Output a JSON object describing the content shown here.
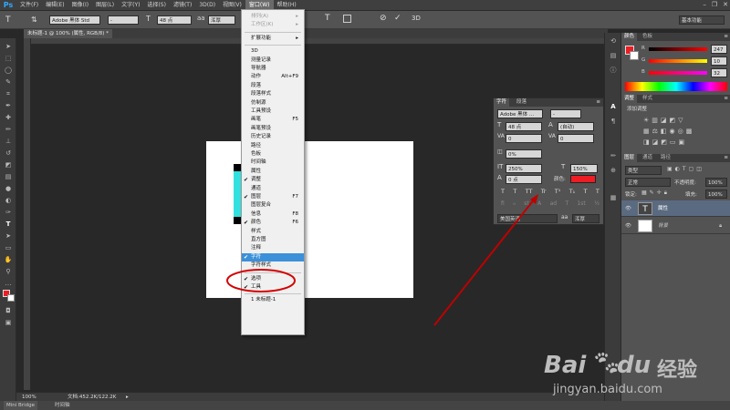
{
  "app": {
    "logo": "Ps"
  },
  "menubar": {
    "items": [
      "文件(F)",
      "编辑(E)",
      "图像(I)",
      "图层(L)",
      "文字(Y)",
      "选择(S)",
      "滤镜(T)",
      "3D(D)",
      "视图(V)",
      "窗口(W)",
      "帮助(H)"
    ],
    "active_index": 9
  },
  "options": {
    "font_family": "Adobe 黑体 Std",
    "font_style": "-",
    "font_size": "48 点",
    "antialias": "浑厚",
    "workspace": "基本功能"
  },
  "document": {
    "tab_title": "未标题-1 @ 100% (属性, RGB/8) *",
    "zoom": "100%",
    "doc_size": "文档:452.2K/122.2K"
  },
  "bottom_tabs": [
    "Mini Bridge",
    "时间轴"
  ],
  "dropdown": {
    "items": [
      {
        "label": "排列(A)",
        "submenu": true,
        "disabled": true
      },
      {
        "label": "工作区(K)",
        "submenu": true,
        "disabled": true
      },
      {
        "sep": true
      },
      {
        "label": "扩展功能",
        "submenu": true
      },
      {
        "sep": true
      },
      {
        "label": "3D"
      },
      {
        "label": "测量记录"
      },
      {
        "label": "导航器"
      },
      {
        "label": "动作",
        "shortcut": "Alt+F9"
      },
      {
        "label": "段落"
      },
      {
        "label": "段落样式"
      },
      {
        "label": "仿制源"
      },
      {
        "label": "工具预设"
      },
      {
        "label": "画笔",
        "shortcut": "F5"
      },
      {
        "label": "画笔预设"
      },
      {
        "label": "历史记录"
      },
      {
        "label": "路径"
      },
      {
        "label": "色板"
      },
      {
        "label": "时间轴"
      },
      {
        "label": "属性"
      },
      {
        "label": "调整",
        "checked": true
      },
      {
        "label": "通道"
      },
      {
        "label": "图层",
        "shortcut": "F7",
        "checked": true
      },
      {
        "label": "图层复合"
      },
      {
        "label": "信息",
        "shortcut": "F8"
      },
      {
        "label": "颜色",
        "shortcut": "F6",
        "checked": true
      },
      {
        "label": "样式"
      },
      {
        "label": "直方图"
      },
      {
        "label": "注释"
      },
      {
        "label": "字符",
        "checked": true,
        "selected": true
      },
      {
        "label": "字符样式"
      },
      {
        "sep": true
      },
      {
        "label": "选项",
        "checked": true
      },
      {
        "label": "工具",
        "checked": true
      },
      {
        "sep": true
      },
      {
        "label": "1 未标题-1"
      }
    ]
  },
  "char_panel": {
    "tabs": [
      "字符",
      "段落"
    ],
    "font_family": "Adobe 黑体 ...",
    "font_style": "-",
    "size": "48 点",
    "leading": "(自动)",
    "kerning": "0",
    "tracking": "0",
    "tsume": "0%",
    "vscale": "250%",
    "hscale": "150%",
    "baseline": "0 点",
    "color_label": "颜色:",
    "language": "美国英语",
    "antialias": "浑厚",
    "style_buttons": [
      "T",
      "T",
      "TT",
      "Tr",
      "T¹",
      "T₁",
      "T",
      "T"
    ],
    "text_color": "#ee1c24"
  },
  "color_panel": {
    "tabs": [
      "颜色",
      "色板"
    ],
    "r": "247",
    "g": "10",
    "b": "32",
    "r_label": "R",
    "g_label": "G",
    "b_label": "B"
  },
  "adjust_panel": {
    "tabs": [
      "调整",
      "样式"
    ],
    "title": "添加调整"
  },
  "layers_panel": {
    "tabs": [
      "图层",
      "通道",
      "路径"
    ],
    "kind_label": "类型",
    "blend_mode": "正常",
    "opacity_label": "不透明度:",
    "opacity": "100%",
    "lock_label": "锁定:",
    "fill_label": "填充:",
    "fill": "100%",
    "layers": [
      {
        "name": "属性",
        "type": "text",
        "selected": true
      },
      {
        "name": "背景",
        "type": "background",
        "selected": false
      }
    ]
  },
  "watermark": {
    "brand": "Bai",
    "brand2": "du",
    "cn": "经验",
    "url": "jingyan.baidu.com"
  },
  "colors": {
    "accent": "#3b90d9",
    "annotation_red": "#d40000",
    "fg_swatch": "#ee1c24"
  }
}
